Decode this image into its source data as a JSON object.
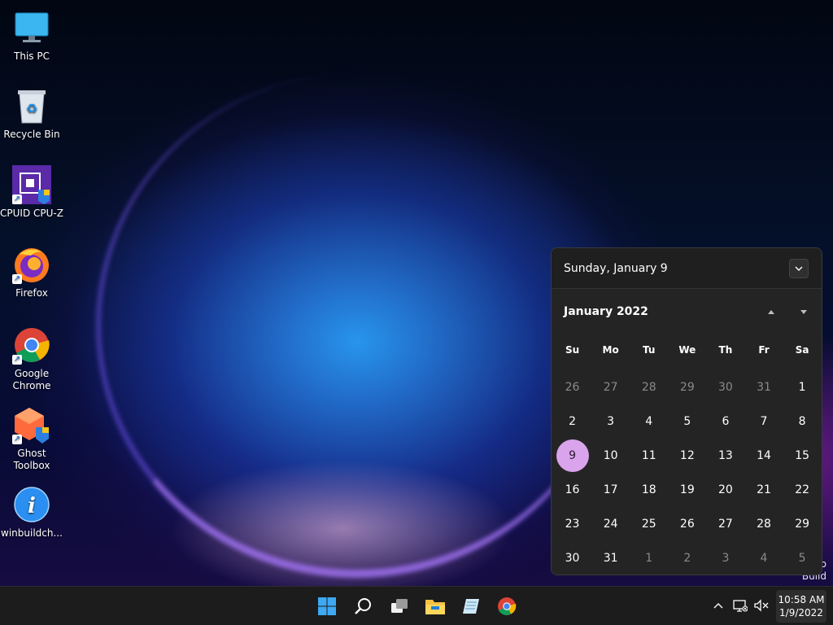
{
  "desktop": {
    "icons": [
      {
        "label": "This PC"
      },
      {
        "label": "Recycle Bin"
      },
      {
        "label": "CPUID CPU-Z"
      },
      {
        "label": "Firefox"
      },
      {
        "label": "Google Chrome"
      },
      {
        "label": "Ghost Toolbox"
      },
      {
        "label": "winbuildch..."
      }
    ],
    "watermark": {
      "line1": "o",
      "line2": "Build"
    }
  },
  "calendar": {
    "header_date": "Sunday, January 9",
    "month_label": "January 2022",
    "weekdays": [
      "Su",
      "Mo",
      "Tu",
      "We",
      "Th",
      "Fr",
      "Sa"
    ],
    "weeks": [
      [
        "26",
        "27",
        "28",
        "29",
        "30",
        "31",
        "1"
      ],
      [
        "2",
        "3",
        "4",
        "5",
        "6",
        "7",
        "8"
      ],
      [
        "9",
        "10",
        "11",
        "12",
        "13",
        "14",
        "15"
      ],
      [
        "16",
        "17",
        "18",
        "19",
        "20",
        "21",
        "22"
      ],
      [
        "23",
        "24",
        "25",
        "26",
        "27",
        "28",
        "29"
      ],
      [
        "30",
        "31",
        "1",
        "2",
        "3",
        "4",
        "5"
      ]
    ],
    "today": "9",
    "accent_color": "#d9a4ec"
  },
  "taskbar": {
    "apps": [
      "start-icon",
      "search-icon",
      "task-view-icon",
      "file-explorer-icon",
      "notepad-icon",
      "chrome-icon"
    ],
    "tray": [
      "chevron-up-icon",
      "network-icon",
      "volume-muted-icon"
    ],
    "clock_time": "10:58 AM",
    "clock_date": "1/9/2022"
  }
}
